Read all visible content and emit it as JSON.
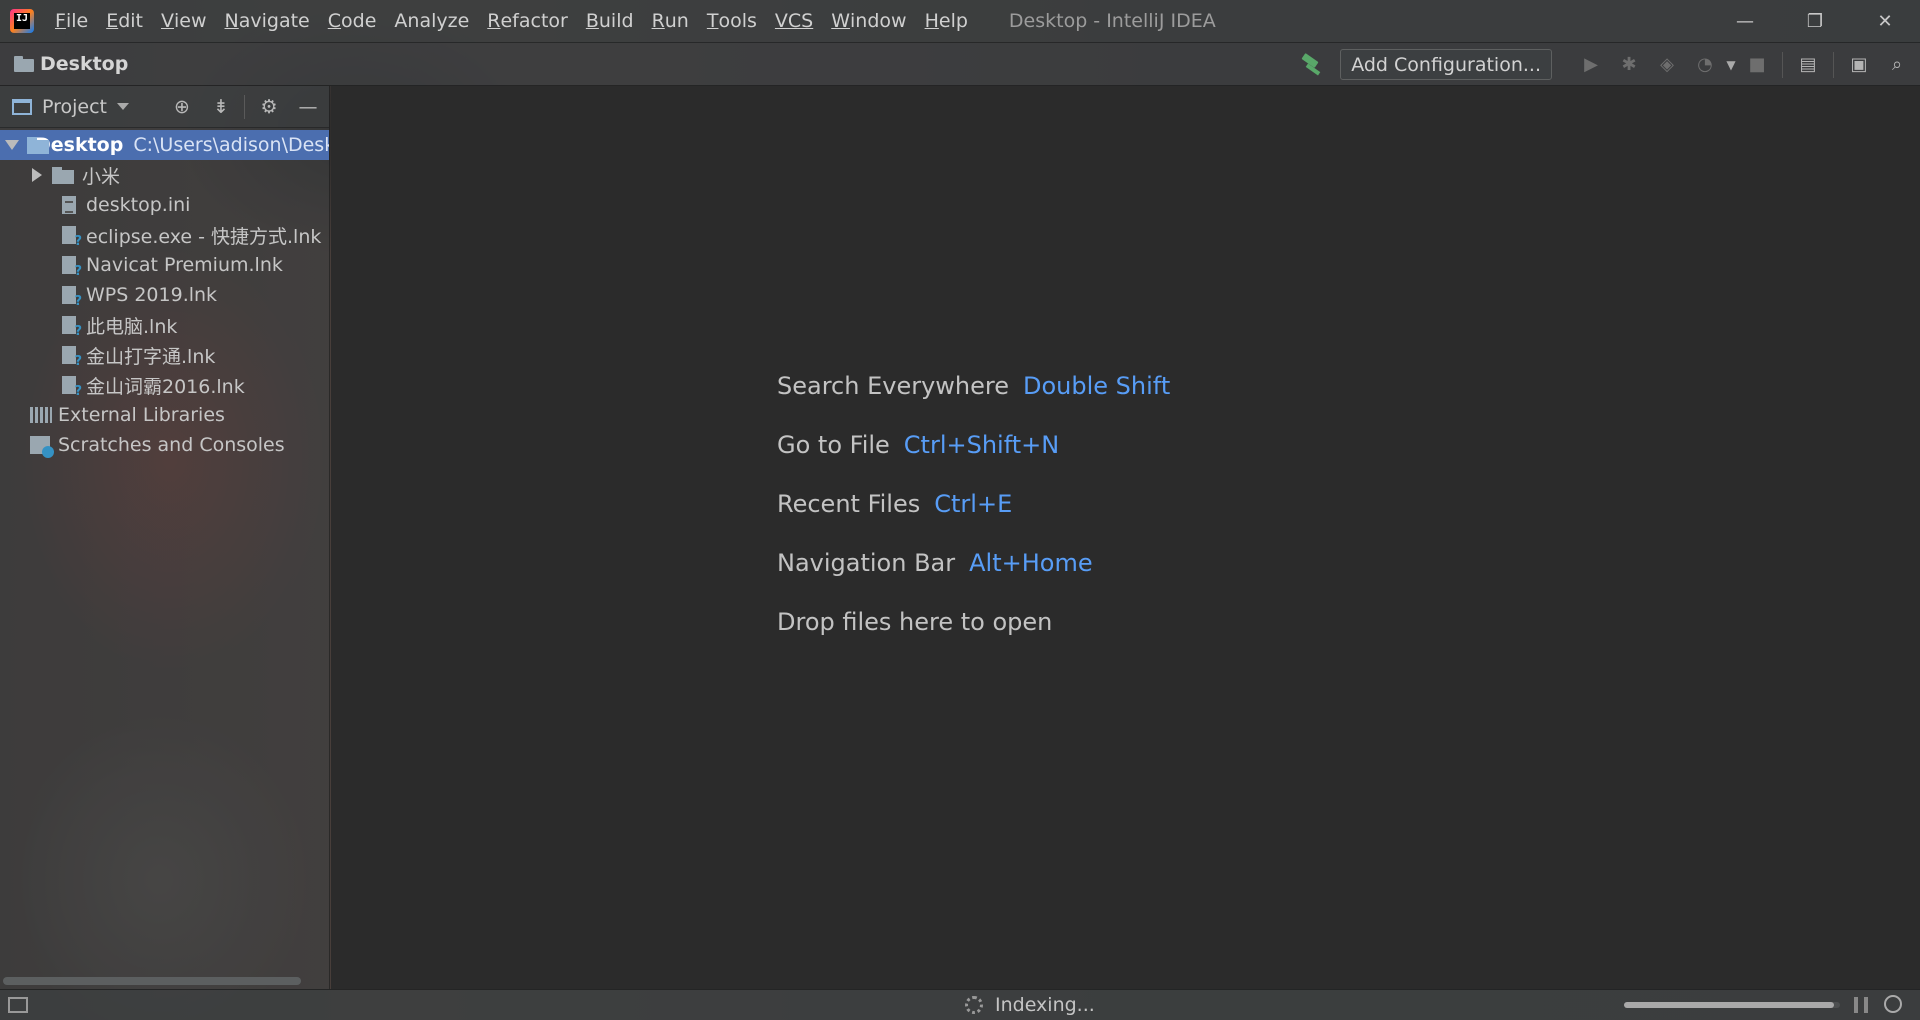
{
  "window": {
    "title": "Desktop - IntelliJ IDEA",
    "controls": {
      "minimize": "—",
      "restore": "❐",
      "close": "✕"
    }
  },
  "menu": [
    {
      "label": "File",
      "mnemonic": "F",
      "rest": "ile"
    },
    {
      "label": "Edit",
      "mnemonic": "E",
      "rest": "dit"
    },
    {
      "label": "View",
      "mnemonic": "V",
      "rest": "iew"
    },
    {
      "label": "Navigate",
      "mnemonic": "N",
      "rest": "avigate"
    },
    {
      "label": "Code",
      "mnemonic": "C",
      "rest": "ode"
    },
    {
      "label": "Analyze",
      "mnemonic": "",
      "rest": "Analyze"
    },
    {
      "label": "Refactor",
      "mnemonic": "R",
      "rest": "efactor"
    },
    {
      "label": "Build",
      "mnemonic": "B",
      "rest": "uild"
    },
    {
      "label": "Run",
      "mnemonic": "R",
      "rest": "un"
    },
    {
      "label": "Tools",
      "mnemonic": "T",
      "rest": "ools"
    },
    {
      "label": "VCS",
      "mnemonic": "",
      "rest": "VCS"
    },
    {
      "label": "Window",
      "mnemonic": "W",
      "rest": "indow"
    },
    {
      "label": "Help",
      "mnemonic": "H",
      "rest": "elp"
    }
  ],
  "navbar": {
    "breadcrumb": "Desktop",
    "config_button": "Add Configuration..."
  },
  "project_panel": {
    "title": "Project",
    "root": {
      "name": "Desktop",
      "path": "C:\\Users\\adison\\Desktop"
    },
    "items": [
      {
        "name": "小米",
        "type": "folder"
      },
      {
        "name": "desktop.ini",
        "type": "file"
      },
      {
        "name": "eclipse.exe - 快捷方式.lnk",
        "type": "lnk"
      },
      {
        "name": "Navicat Premium.lnk",
        "type": "lnk"
      },
      {
        "name": "WPS 2019.lnk",
        "type": "lnk"
      },
      {
        "name": "此电脑.lnk",
        "type": "lnk"
      },
      {
        "name": "金山打字通.lnk",
        "type": "lnk"
      },
      {
        "name": "金山词霸2016.lnk",
        "type": "lnk"
      }
    ],
    "external_libraries": "External Libraries",
    "scratches": "Scratches and Consoles"
  },
  "editor_hints": [
    {
      "label": "Search Everywhere",
      "shortcut": "Double Shift"
    },
    {
      "label": "Go to File",
      "shortcut": "Ctrl+Shift+N"
    },
    {
      "label": "Recent Files",
      "shortcut": "Ctrl+E"
    },
    {
      "label": "Navigation Bar",
      "shortcut": "Alt+Home"
    },
    {
      "label": "Drop files here to open",
      "shortcut": ""
    }
  ],
  "status": {
    "indexing": "Indexing...",
    "progress": 0.97
  },
  "colors": {
    "accent": "#4b6eaf",
    "shortcut": "#589df6",
    "build": "#59a869"
  }
}
